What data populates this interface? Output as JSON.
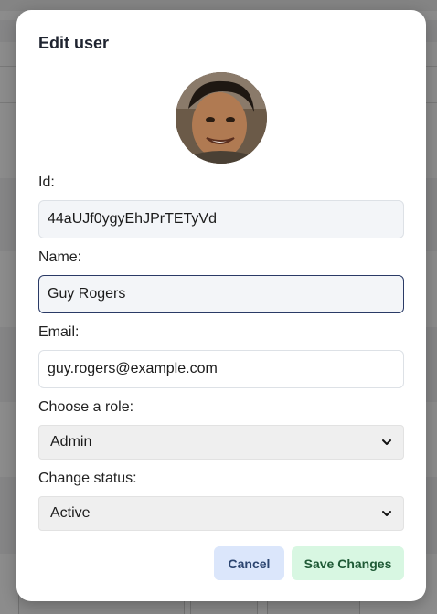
{
  "modal": {
    "title": "Edit user"
  },
  "user": {
    "avatar_alt": "user avatar"
  },
  "fields": {
    "id": {
      "label": "Id:",
      "value": "44aUJf0ygyEhJPrTETyVd"
    },
    "name": {
      "label": "Name:",
      "value": "Guy Rogers"
    },
    "email": {
      "label": "Email:",
      "value": "guy.rogers@example.com"
    },
    "role": {
      "label": "Choose a role:",
      "selected": "Admin"
    },
    "status": {
      "label": "Change status:",
      "selected": "Active"
    }
  },
  "actions": {
    "cancel_label": "Cancel",
    "save_label": "Save Changes"
  },
  "colors": {
    "overlay": "#000000",
    "focus_border": "#2a3a66",
    "cancel_bg": "#dbe6fb",
    "save_bg": "#d8f7e2"
  }
}
